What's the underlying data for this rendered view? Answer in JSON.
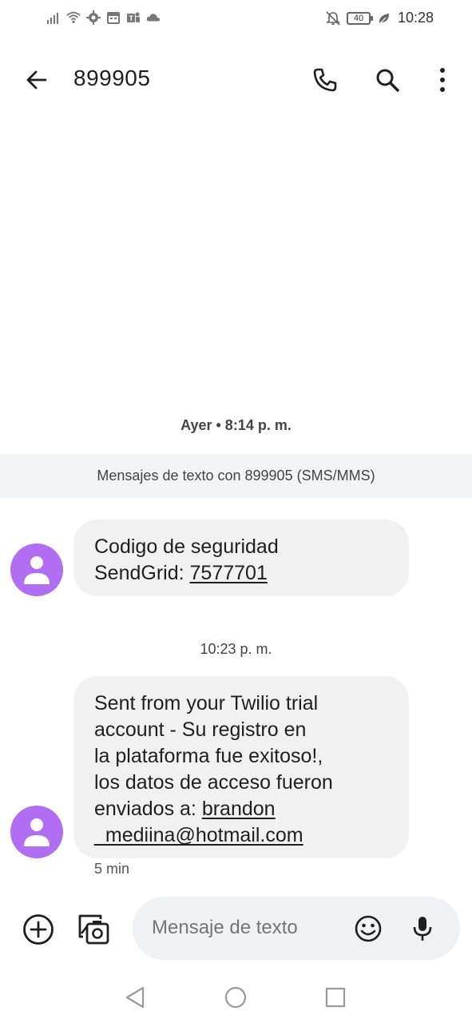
{
  "status_bar": {
    "battery": "40",
    "time": "10:28",
    "icons_left": [
      "signal-icon",
      "wifi-icon",
      "settings-icon",
      "calendar-icon",
      "teams-icon",
      "cloud-icon"
    ],
    "icons_right": [
      "notifications-off-icon",
      "battery-icon",
      "eco-leaf-icon"
    ]
  },
  "app_bar": {
    "title": "899905",
    "actions": [
      "call-icon",
      "search-icon",
      "more-vert-icon"
    ]
  },
  "conversation": {
    "day_label": "Ayer • 8:14 p. m.",
    "info_band": "Mensajes de texto con 899905 (SMS/MMS)",
    "messages": [
      {
        "line1": "Codigo de seguridad",
        "line2_prefix": "SendGrid: ",
        "line2_link": "7577701"
      },
      {
        "line1": "Sent from your Twilio trial",
        "line2": "account - Su registro en",
        "line3": "la plataforma fue exitoso!,",
        "line4": "los datos de acceso fueron",
        "line5_prefix": "enviados a: ",
        "line5_link": "brandon",
        "line6_link": "_mediina@hotmail.com"
      }
    ],
    "time_label": "10:23 p. m.",
    "ago": "5 min"
  },
  "compose": {
    "placeholder": "Mensaje de texto"
  },
  "colors": {
    "avatar": "#b16ef2",
    "bubble": "#f1f1f1",
    "info_band": "#f3f4f8",
    "input_pill": "#f0f1f5"
  }
}
